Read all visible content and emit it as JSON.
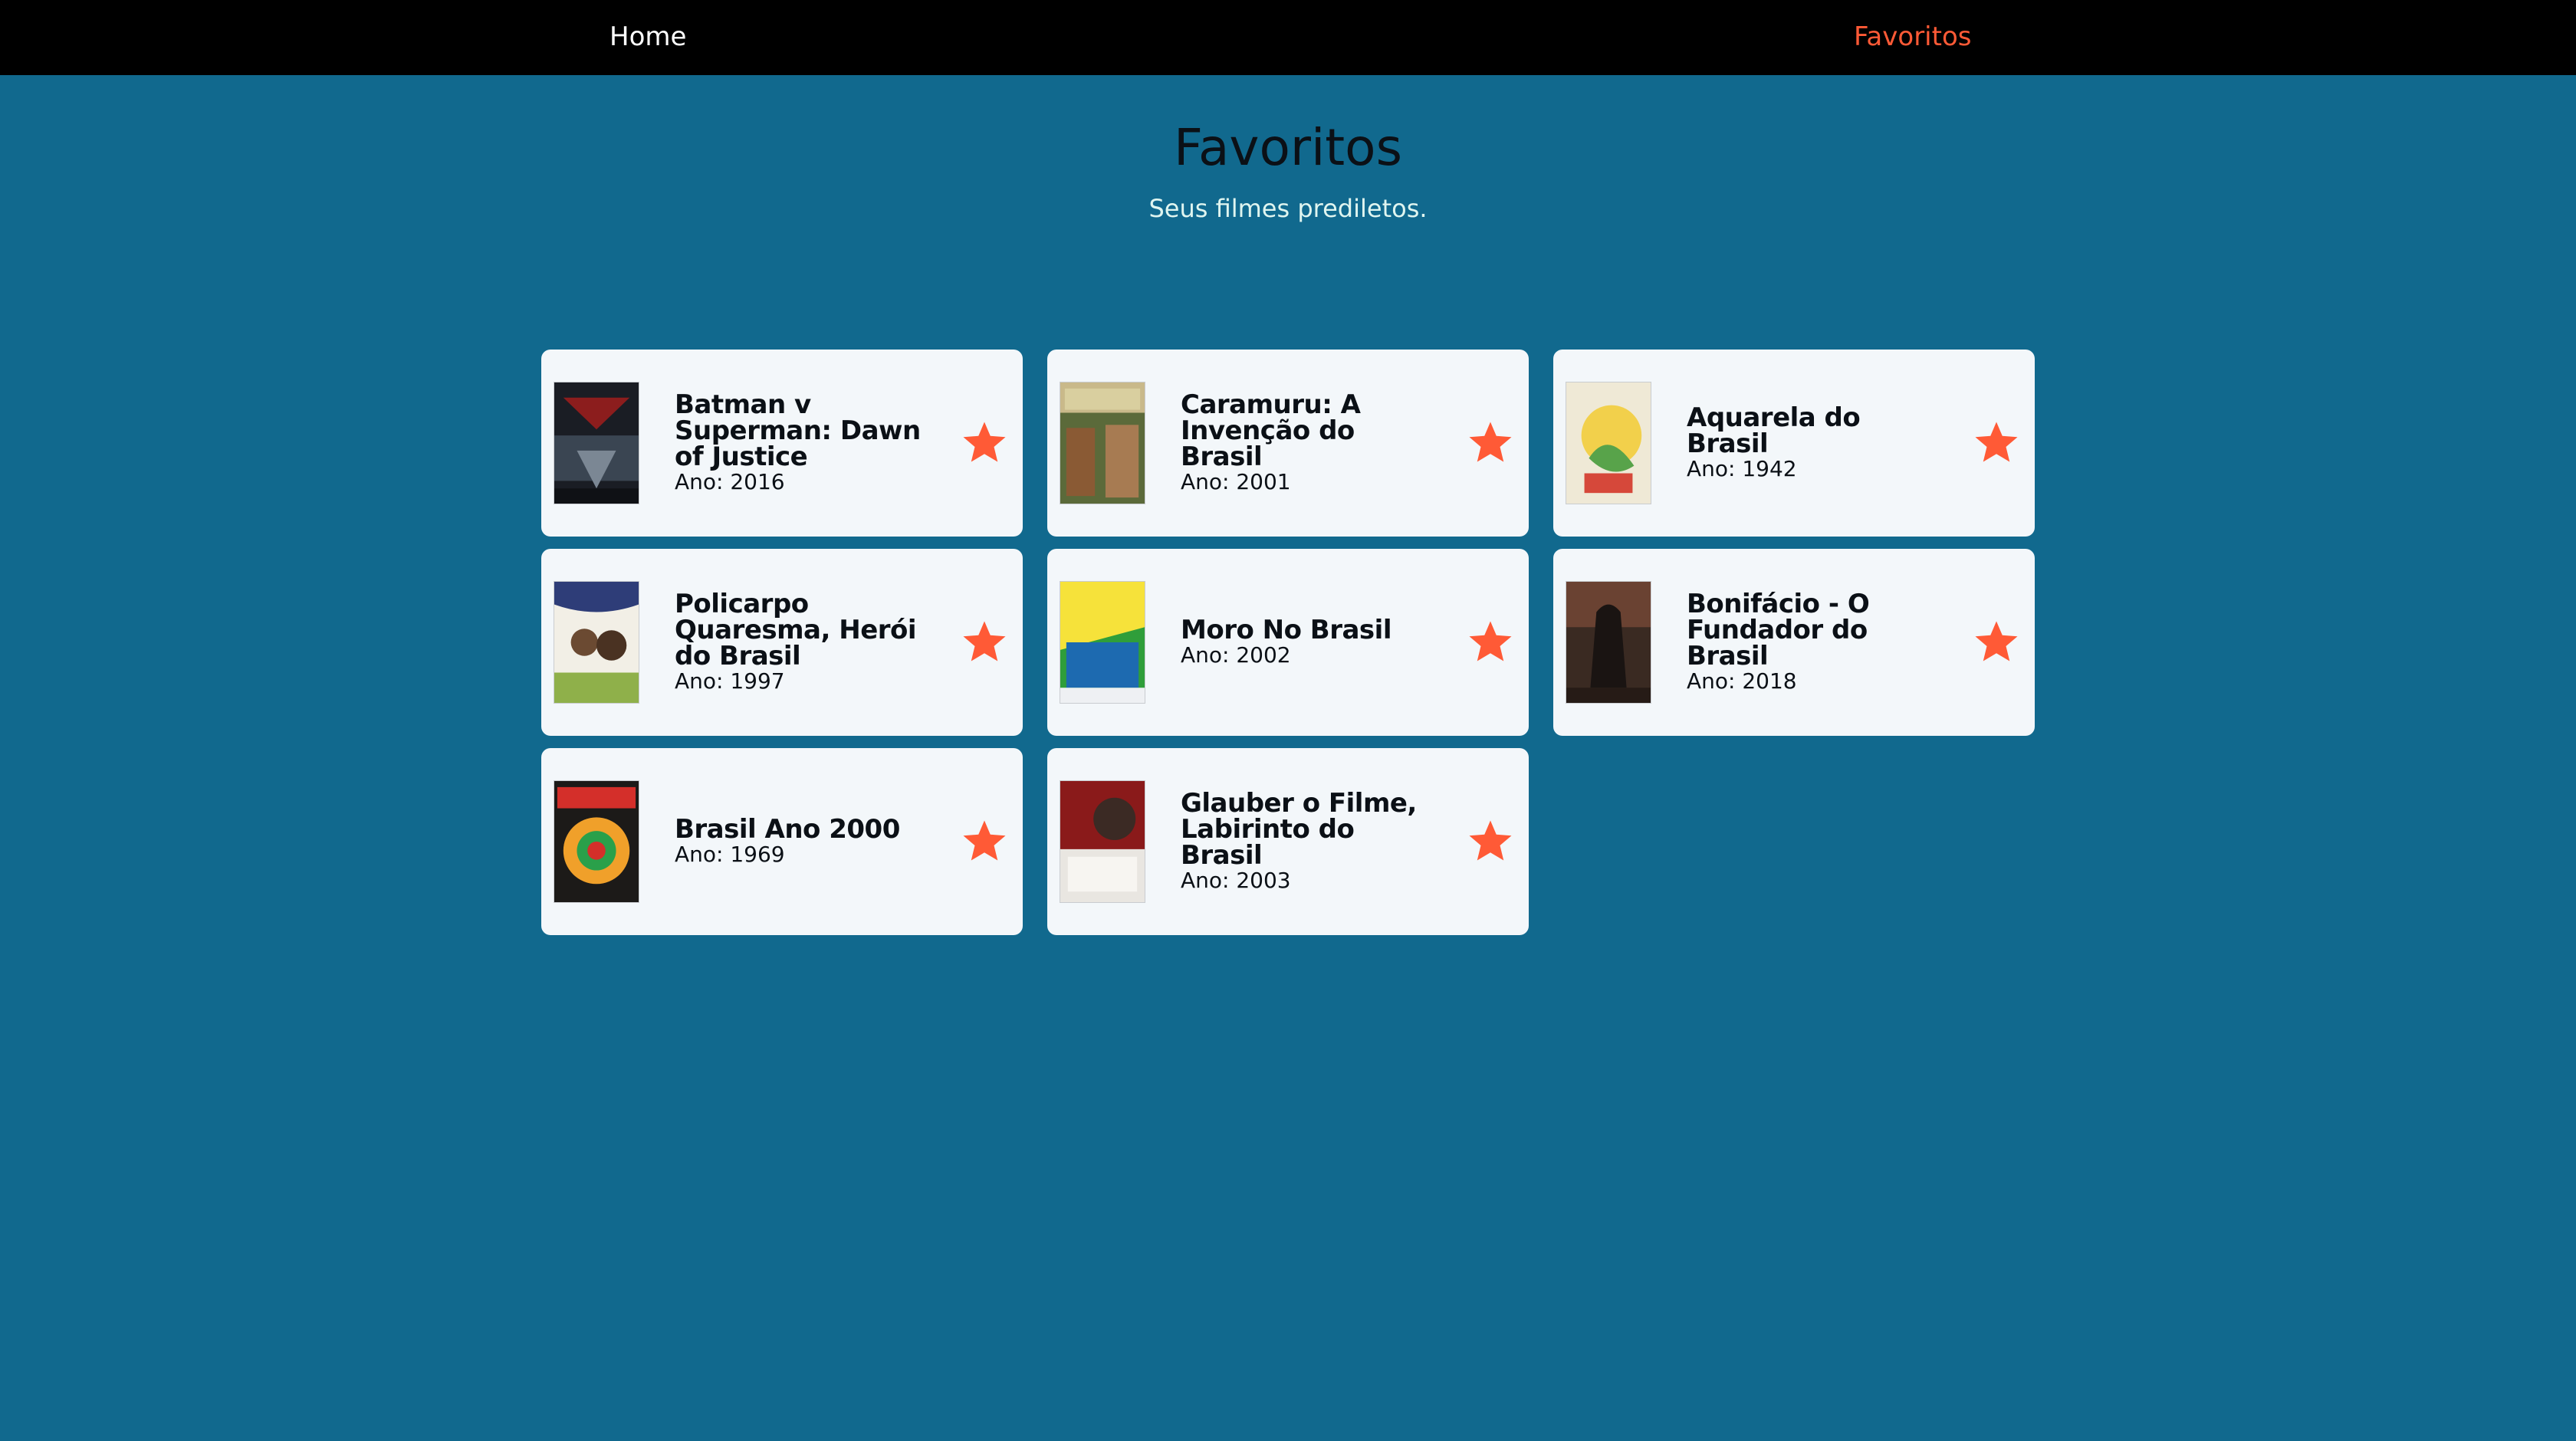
{
  "nav": {
    "home_label": "Home",
    "favorites_label": "Favoritos"
  },
  "header": {
    "title": "Favoritos",
    "subtitle": "Seus filmes prediletos."
  },
  "colors": {
    "background": "#11698e",
    "navbar": "#000000",
    "accent": "#ff5a36",
    "card": "#f3f7fa"
  },
  "favorites": [
    {
      "title": "Batman v Superman: Dawn of Justice",
      "year_label": "Ano: 2016",
      "icon": "star-icon"
    },
    {
      "title": "Caramuru: A Invenção do Brasil",
      "year_label": "Ano: 2001",
      "icon": "star-icon"
    },
    {
      "title": "Aquarela do Brasil",
      "year_label": "Ano: 1942",
      "icon": "star-icon"
    },
    {
      "title": "Policarpo Quaresma, Herói do Brasil",
      "year_label": "Ano: 1997",
      "icon": "star-icon"
    },
    {
      "title": "Moro No Brasil",
      "year_label": "Ano: 2002",
      "icon": "star-icon"
    },
    {
      "title": "Bonifácio - O Fundador do Brasil",
      "year_label": "Ano: 2018",
      "icon": "star-icon"
    },
    {
      "title": "Brasil Ano 2000",
      "year_label": "Ano: 1969",
      "icon": "star-icon"
    },
    {
      "title": "Glauber o Filme, Labirinto do Brasil",
      "year_label": "Ano: 2003",
      "icon": "star-icon"
    }
  ]
}
